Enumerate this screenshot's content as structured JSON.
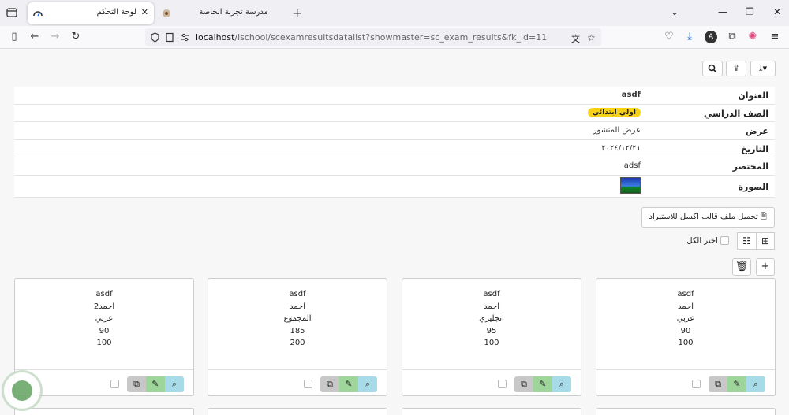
{
  "browser": {
    "tabs": [
      {
        "title": "لوحة التحكم",
        "active": true
      },
      {
        "title": "مدرسة تجربة الخاصة",
        "active": false
      }
    ],
    "url_host": "localhost",
    "url_rest": "/ischool/scexamresultsdatalist?showmaster=sc_exam_results&fk_id=11"
  },
  "record": {
    "rows": [
      {
        "label": "العنوان",
        "value": "asdf"
      },
      {
        "label": "الصف الدراسي",
        "value": "اولي ابتدائي"
      },
      {
        "label": "عرض",
        "value": "عرض المنشور"
      },
      {
        "label": "التاريخ",
        "value": "٢٠٢٤/١٢/٢١"
      },
      {
        "label": "المختصر",
        "value": "adsf"
      },
      {
        "label": "الصورة",
        "value": ""
      }
    ]
  },
  "controls": {
    "download_template": "تحميل ملف قالب اكسل للاستيراد",
    "select_all": "اختر الكل"
  },
  "cards": [
    {
      "lines": [
        "asdf",
        "احمد",
        "عربي",
        "90",
        "100"
      ]
    },
    {
      "lines": [
        "asdf",
        "احمد",
        "انجليزي",
        "95",
        "100"
      ]
    },
    {
      "lines": [
        "asdf",
        "احمد",
        "المجموع",
        "185",
        "200"
      ]
    },
    {
      "lines": [
        "asdf",
        "احمد2",
        "عربي",
        "90",
        "100"
      ]
    }
  ],
  "colors": {
    "grade_badge": "#f7d21a",
    "edit_button": "#9ed59a",
    "view_button": "#a8dbe8",
    "copy_button": "#c8c8c8"
  }
}
